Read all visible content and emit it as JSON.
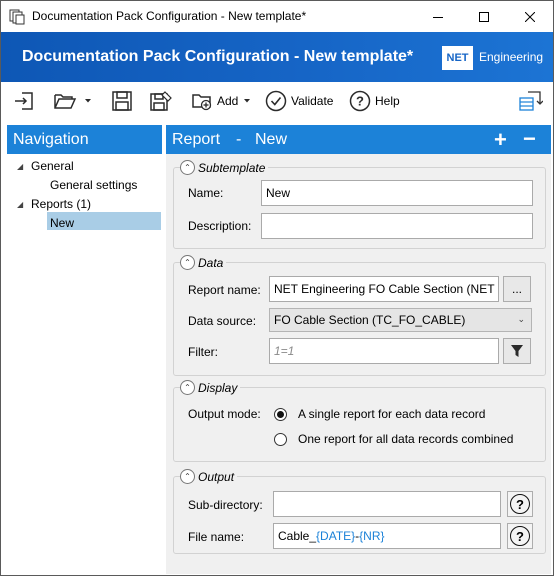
{
  "window": {
    "title": "Documentation Pack Configuration - New template*"
  },
  "banner": {
    "title": "Documentation Pack Configuration - New template*",
    "logo_mark": "NET",
    "logo_text": "Engineering"
  },
  "toolbar": {
    "add_label": "Add",
    "validate_label": "Validate",
    "help_label": "Help"
  },
  "navigation": {
    "title": "Navigation",
    "tree": {
      "general": "General",
      "general_settings": "General settings",
      "reports": "Reports (1)",
      "new": "New"
    }
  },
  "main": {
    "header_left": "Report",
    "header_sep": "-",
    "header_right": "New",
    "add_symbol": "+",
    "remove_symbol": "−",
    "subtemplate": {
      "title": "Subtemplate",
      "name_label": "Name:",
      "name_value": "New",
      "description_label": "Description:",
      "description_value": ""
    },
    "data": {
      "title": "Data",
      "report_name_label": "Report name:",
      "report_name_value": "NET Engineering FO Cable Section (NET FO",
      "browse_label": "...",
      "data_source_label": "Data source:",
      "data_source_value": "FO Cable Section (TC_FO_CABLE)",
      "filter_label": "Filter:",
      "filter_placeholder": "1=1"
    },
    "display": {
      "title": "Display",
      "output_mode_label": "Output mode:",
      "option_single": "A single report for each data record",
      "option_combined": "One report for all data records combined",
      "selected": "single"
    },
    "output": {
      "title": "Output",
      "subdir_label": "Sub-directory:",
      "subdir_value": "",
      "filename_label": "File name:",
      "filename_prefix": "Cable_",
      "filename_date": "{DATE}",
      "filename_dash": "-",
      "filename_nr": "{NR}"
    }
  },
  "colors": {
    "accent": "#1c82d8",
    "banner": "#1665c6",
    "selection": "#a9cde6"
  }
}
